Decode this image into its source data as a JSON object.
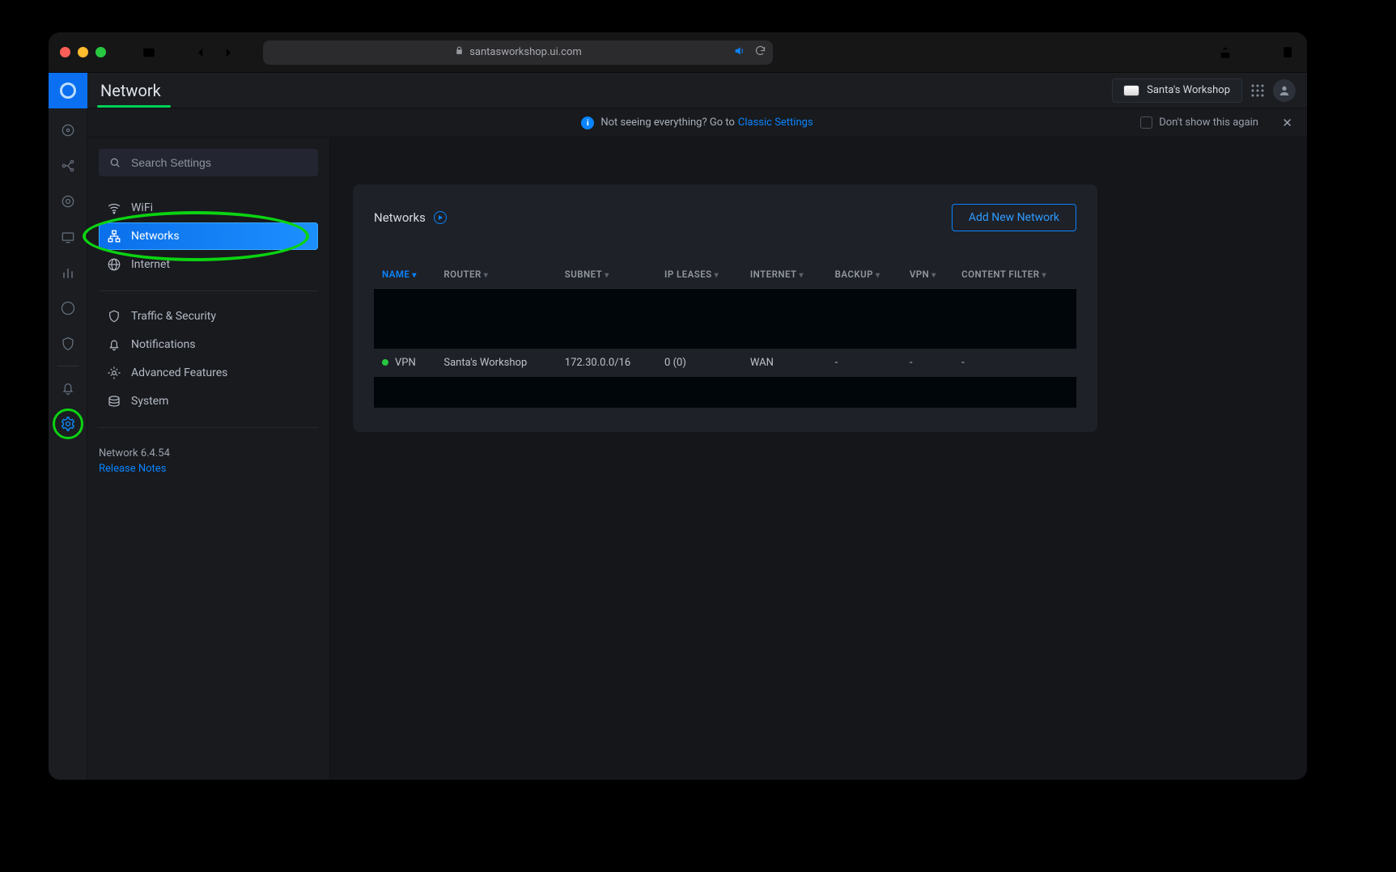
{
  "browser": {
    "url": "santasworkshop.ui.com"
  },
  "header": {
    "title": "Network",
    "site_button": "Santa's Workshop"
  },
  "banner": {
    "text": "Not seeing everything? Go to",
    "link": "Classic Settings",
    "dismiss": "Don't show this again"
  },
  "sidebar": {
    "search_placeholder": "Search Settings",
    "items": [
      {
        "label": "WiFi",
        "icon": "wifi"
      },
      {
        "label": "Networks",
        "icon": "lan",
        "active": true
      },
      {
        "label": "Internet",
        "icon": "globe"
      }
    ],
    "items2": [
      {
        "label": "Traffic & Security",
        "icon": "shield"
      },
      {
        "label": "Notifications",
        "icon": "bell"
      },
      {
        "label": "Advanced Features",
        "icon": "gear"
      },
      {
        "label": "System",
        "icon": "stack"
      }
    ],
    "version": "Network 6.4.54",
    "release_notes": "Release Notes"
  },
  "networks_card": {
    "title": "Networks",
    "add_button": "Add New Network",
    "columns": [
      "NAME",
      "ROUTER",
      "SUBNET",
      "IP LEASES",
      "INTERNET",
      "BACKUP",
      "VPN",
      "CONTENT FILTER"
    ],
    "row": {
      "name": "VPN",
      "router": "Santa's Workshop",
      "subnet": "172.30.0.0/16",
      "ip_leases": "0 (0)",
      "internet": "WAN",
      "backup": "-",
      "vpn": "-",
      "content_filter": "-"
    }
  }
}
